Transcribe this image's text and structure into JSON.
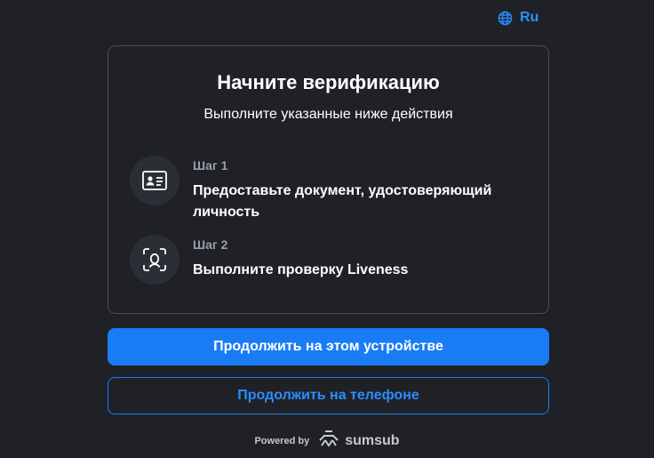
{
  "language": {
    "label": "Ru",
    "icon": "globe-icon"
  },
  "card": {
    "title": "Начните верификацию",
    "subtitle": "Выполните указанные ниже действия",
    "steps": [
      {
        "label": "Шаг 1",
        "description": "Предоставьте документ, удостоверяющий личность",
        "icon": "id-card-icon"
      },
      {
        "label": "Шаг 2",
        "description": "Выполните проверку Liveness",
        "icon": "face-scan-icon"
      }
    ]
  },
  "actions": {
    "continue_here": "Продолжить на этом устройстве",
    "continue_phone": "Продолжить на телефоне"
  },
  "footer": {
    "powered_by": "Powered by",
    "brand": "sumsub",
    "brand_icon": "sumsub-logo-icon"
  },
  "colors": {
    "background": "#1f2127",
    "accent": "#1a7cf5",
    "link": "#2c8dff",
    "muted_text": "#9a9ea8",
    "icon_circle": "#2b2e35"
  }
}
